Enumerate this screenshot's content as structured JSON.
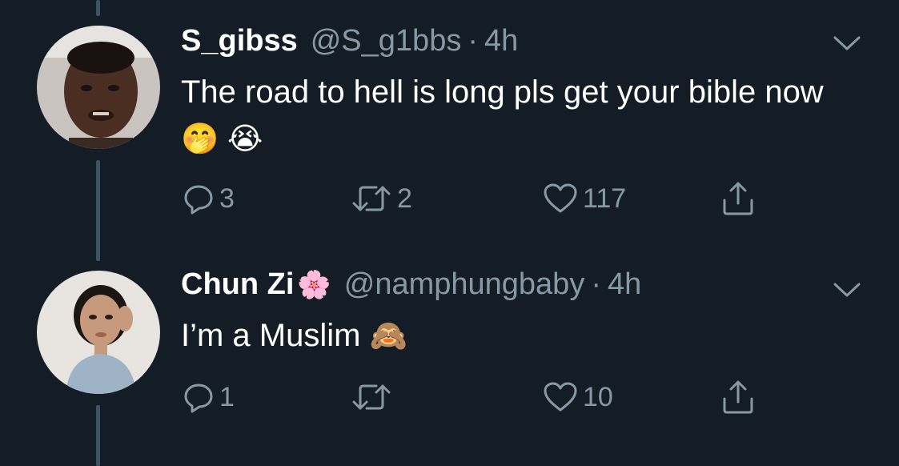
{
  "tweets": [
    {
      "name": "S_gibss",
      "handle": "@S_g1bbs",
      "separator": "·",
      "time": "4h",
      "text": "The road to hell is long pls get your bible now",
      "emojis": "🤭 😭",
      "replies": "3",
      "retweets": "2",
      "likes": "117"
    },
    {
      "name": "Chun Zi",
      "name_emoji": "🌸",
      "handle": "@namphungbaby",
      "separator": "·",
      "time": "4h",
      "text": "I’m a Muslim",
      "emojis": "🙈",
      "replies": "1",
      "retweets": "",
      "likes": "10"
    }
  ],
  "icons": {
    "reply": "reply-icon",
    "retweet": "retweet-icon",
    "like": "heart-icon",
    "share": "share-icon",
    "menu": "chevron-down-icon"
  },
  "colors": {
    "background": "#141d26",
    "secondary_text": "#8899a6",
    "thread_line": "#3d5466"
  }
}
